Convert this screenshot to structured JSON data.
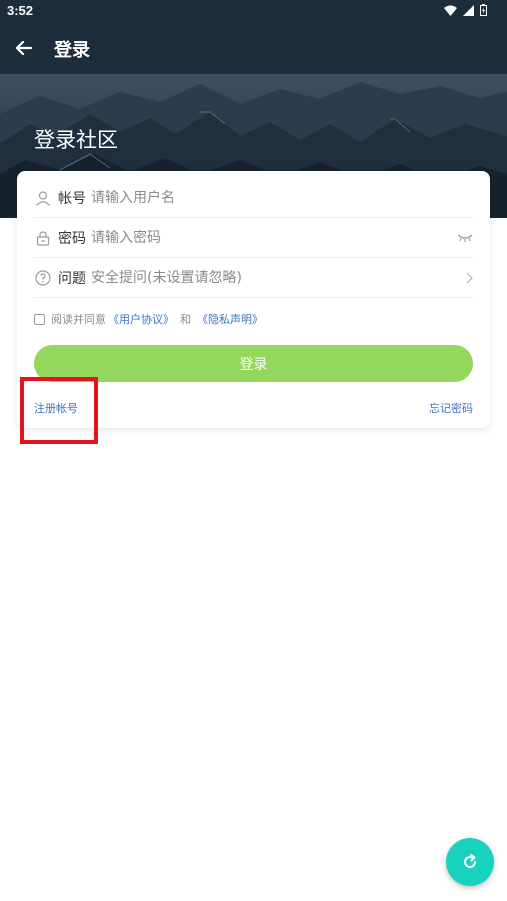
{
  "status_bar": {
    "time": "3:52"
  },
  "app_bar": {
    "title": "登录"
  },
  "hero": {
    "title": "登录社区"
  },
  "form": {
    "account": {
      "label": "帐号",
      "placeholder": "请输入用户名",
      "value": ""
    },
    "password": {
      "label": "密码",
      "placeholder": "请输入密码",
      "value": ""
    },
    "question": {
      "label": "问题",
      "placeholder": "安全提问(未设置请忽略)",
      "value": ""
    },
    "agreement": {
      "prefix": "阅读并同意",
      "user_agreement": "《用户协议》",
      "and": "和",
      "privacy": "《隐私声明》",
      "checked": false
    },
    "login_label": "登录",
    "register_label": "注册帐号",
    "forgot_label": "忘记密码"
  },
  "colors": {
    "app_bar": "#1d2d3c",
    "login_button": "#93d75d",
    "link": "#3a76c4",
    "fab": "#19d1bf",
    "highlight": "#e4141e"
  },
  "icons": [
    "back-arrow-icon",
    "user-icon",
    "lock-icon",
    "question-icon",
    "eye-closed-icon",
    "chevron-right-icon",
    "refresh-icon",
    "wifi-icon",
    "signal-icon",
    "battery-icon"
  ]
}
